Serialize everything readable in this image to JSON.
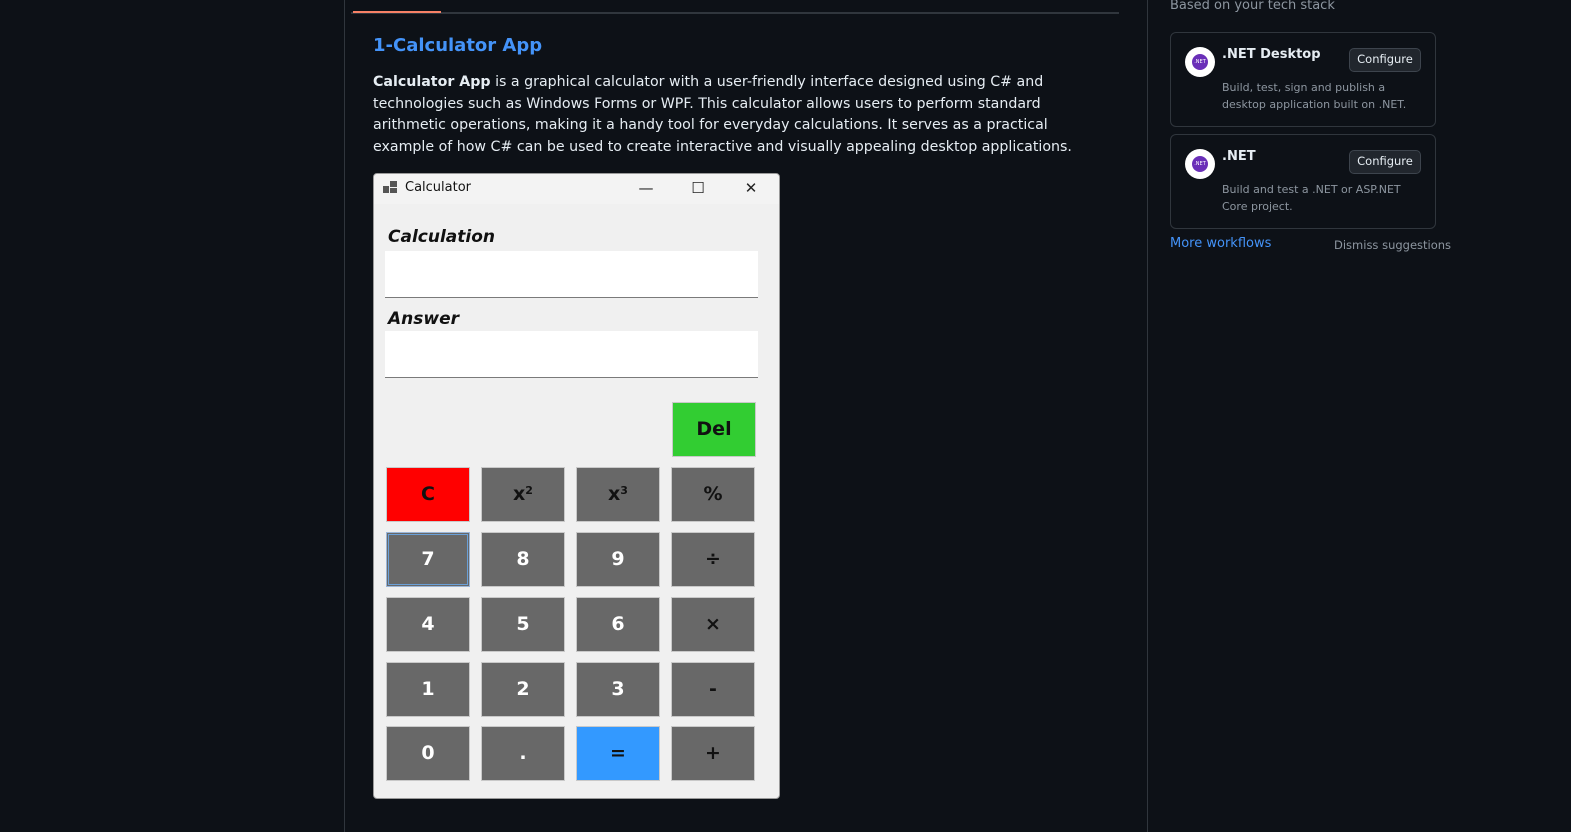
{
  "readme": {
    "heading": "1-Calculator App",
    "para_bold": "Calculator App",
    "para_rest": " is a graphical calculator with a user-friendly interface designed using C# and technologies such as Windows Forms or WPF. This calculator allows users to perform standard arithmetic operations, making it a handy tool for everyday calculations. It serves as a practical example of how C# can be used to create interactive and visually appealing desktop applications."
  },
  "calculator": {
    "window_title": "Calculator",
    "minimize": "—",
    "maximize": "☐",
    "close": "✕",
    "calculation_label": "Calculation",
    "calculation_value": "",
    "answer_label": "Answer",
    "answer_value": "",
    "keys": {
      "del": "Del",
      "clear": "C",
      "square_base": "x",
      "square_exp": "2",
      "cube_base": "x",
      "cube_exp": "3",
      "percent": "%",
      "seven": "7",
      "eight": "8",
      "nine": "9",
      "divide": "÷",
      "four": "4",
      "five": "5",
      "six": "6",
      "multiply": "×",
      "one": "1",
      "two": "2",
      "three": "3",
      "minus": "-",
      "zero": "0",
      "dot": ".",
      "equals": "=",
      "plus": "+"
    },
    "colors": {
      "clear": "#ff0000",
      "del": "#32cd32",
      "equals": "#3399ff",
      "key": "#686868"
    }
  },
  "sidebar": {
    "heading": "Based on your tech stack",
    "cards": [
      {
        "title": ".NET Desktop",
        "button": "Configure",
        "description": "Build, test, sign and publish a desktop application built on .NET.",
        "logo": ".NET"
      },
      {
        "title": ".NET",
        "button": "Configure",
        "description": "Build and test a .NET or ASP.NET Core project.",
        "logo": ".NET"
      }
    ],
    "more_workflows": "More workflows",
    "dismiss": "Dismiss suggestions"
  }
}
